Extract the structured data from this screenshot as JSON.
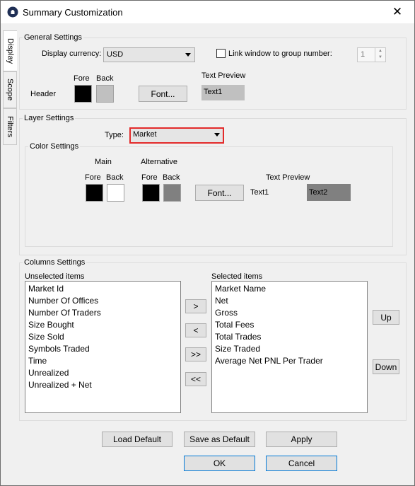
{
  "window": {
    "title": "Summary Customization",
    "close_glyph": "✕"
  },
  "tabs": [
    "Display",
    "Scope",
    "Filters"
  ],
  "general": {
    "legend": "General Settings",
    "currency_label": "Display currency:",
    "currency_value": "USD",
    "link_label": "Link window to group number:",
    "link_checked": false,
    "group_number": "1",
    "fore_label": "Fore",
    "back_label": "Back",
    "text_preview_label": "Text Preview",
    "header_label": "Header",
    "font_button": "Font...",
    "preview_text": "Text1",
    "fore_color": "#000000",
    "back_color": "#c0c0c0"
  },
  "layer": {
    "legend": "Layer Settings",
    "type_label": "Type:",
    "type_value": "Market",
    "color_legend": "Color Settings",
    "main_label": "Main",
    "alternative_label": "Alternative",
    "fore_label": "Fore",
    "back_label": "Back",
    "text_preview_label": "Text Preview",
    "font_button": "Font...",
    "preview_text1": "Text1",
    "preview_text2": "Text2",
    "main_fore": "#000000",
    "main_back": "#ffffff",
    "alt_fore": "#000000",
    "alt_back": "#808080"
  },
  "columns": {
    "legend": "Columns Settings",
    "unselected_label": "Unselected items",
    "selected_label": "Selected items",
    "unselected": [
      "Market Id",
      "Number Of Offices",
      "Number Of Traders",
      "Size Bought",
      "Size Sold",
      "Symbols Traded",
      "Time",
      "Unrealized",
      "Unrealized + Net"
    ],
    "selected": [
      "Market Name",
      "Net",
      "Gross",
      "Total Fees",
      "Total Trades",
      "Size Traded",
      "Average Net PNL Per Trader"
    ],
    "move_right": ">",
    "move_left": "<",
    "move_all_right": ">>",
    "move_all_left": "<<",
    "up": "Up",
    "down": "Down"
  },
  "footer": {
    "load_default": "Load Default",
    "save_default": "Save as Default",
    "apply": "Apply",
    "ok": "OK",
    "cancel": "Cancel"
  }
}
